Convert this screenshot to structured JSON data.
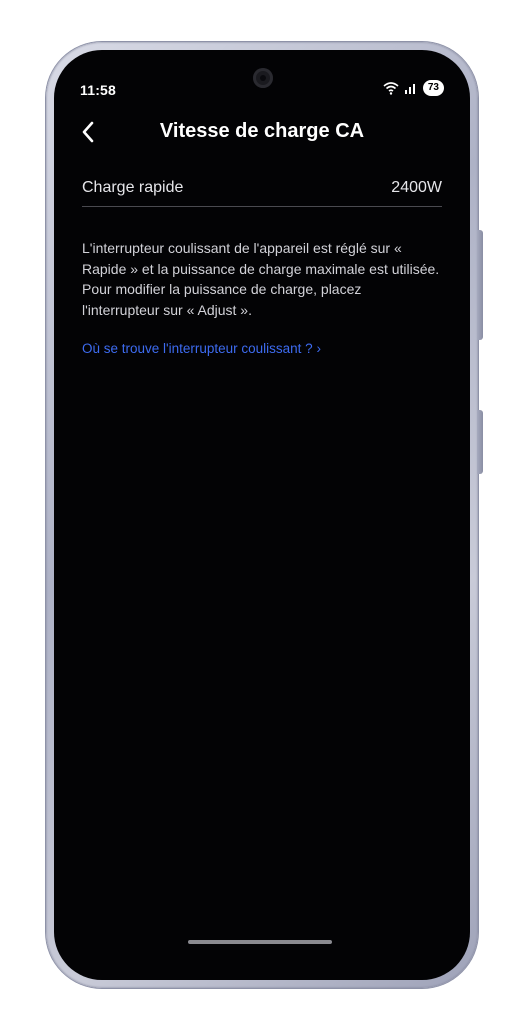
{
  "status_bar": {
    "time": "11:58",
    "battery": "73",
    "icons": [
      "wifi-icon",
      "signal-icon"
    ]
  },
  "header": {
    "back_icon": "chevron-left-icon",
    "title": "Vitesse de charge CA"
  },
  "setting": {
    "label": "Charge rapide",
    "value": "2400W"
  },
  "description": "L'interrupteur coulissant de l'appareil est réglé sur « Rapide » et la puissance de charge maximale est utilisée. Pour modifier la puissance de charge, placez l'interrupteur sur « Adjust ».",
  "help_link": "Où se trouve l'interrupteur coulissant ? ›",
  "colors": {
    "background": "#030305",
    "text": "#ffffff",
    "link": "#3d6bf0",
    "divider": "#4a4a50"
  }
}
